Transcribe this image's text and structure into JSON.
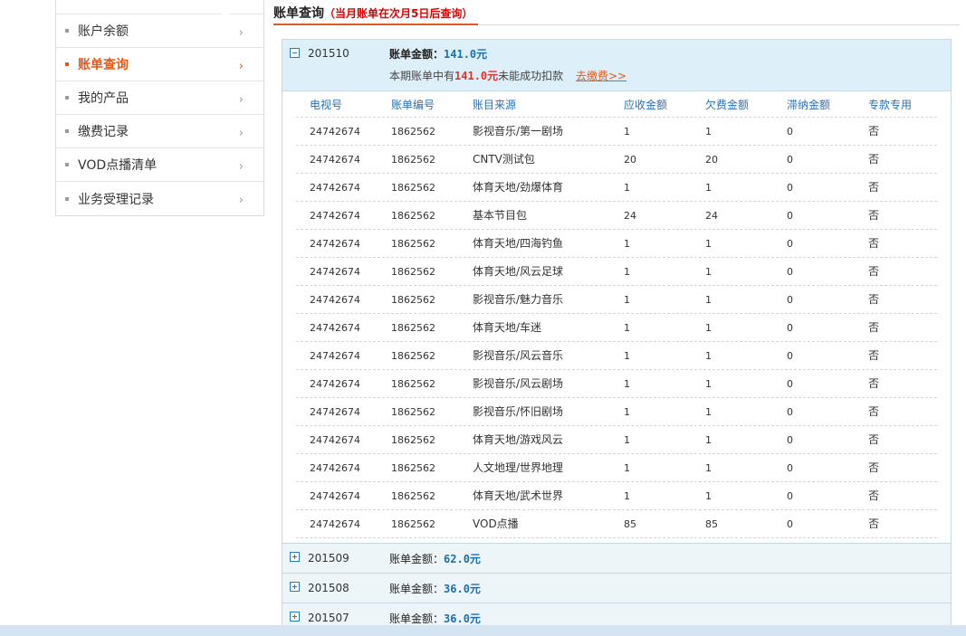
{
  "sidebar": {
    "items": [
      {
        "label": "账户余额",
        "active": false
      },
      {
        "label": "账单查询",
        "active": true
      },
      {
        "label": "我的产品",
        "active": false
      },
      {
        "label": "缴费记录",
        "active": false
      },
      {
        "label": "VOD点播清单",
        "active": false
      },
      {
        "label": "业务受理记录",
        "active": false
      }
    ],
    "chevron": "›"
  },
  "header": {
    "title": "账单查询",
    "note": "（当月账单在次月5日后查询）"
  },
  "bills": [
    {
      "period": "201510",
      "amount_label": "账单金额：",
      "amount": "141.0元",
      "expanded": true,
      "unpaid_prefix": "本期账单中有",
      "unpaid_amount": "141.0元",
      "unpaid_suffix": "未能成功扣款",
      "pay_link": "去缴费>>"
    }
  ],
  "table": {
    "columns": [
      "电视号",
      "账单编号",
      "账目来源",
      "应收金额",
      "欠费金额",
      "滞纳金额",
      "专款专用"
    ],
    "rows": [
      [
        "24742674",
        "1862562",
        "影视音乐/第一剧场",
        "1",
        "1",
        "0",
        "否"
      ],
      [
        "24742674",
        "1862562",
        "CNTV测试包",
        "20",
        "20",
        "0",
        "否"
      ],
      [
        "24742674",
        "1862562",
        "体育天地/劲爆体育",
        "1",
        "1",
        "0",
        "否"
      ],
      [
        "24742674",
        "1862562",
        "基本节目包",
        "24",
        "24",
        "0",
        "否"
      ],
      [
        "24742674",
        "1862562",
        "体育天地/四海钓鱼",
        "1",
        "1",
        "0",
        "否"
      ],
      [
        "24742674",
        "1862562",
        "体育天地/风云足球",
        "1",
        "1",
        "0",
        "否"
      ],
      [
        "24742674",
        "1862562",
        "影视音乐/魅力音乐",
        "1",
        "1",
        "0",
        "否"
      ],
      [
        "24742674",
        "1862562",
        "体育天地/车迷",
        "1",
        "1",
        "0",
        "否"
      ],
      [
        "24742674",
        "1862562",
        "影视音乐/风云音乐",
        "1",
        "1",
        "0",
        "否"
      ],
      [
        "24742674",
        "1862562",
        "影视音乐/风云剧场",
        "1",
        "1",
        "0",
        "否"
      ],
      [
        "24742674",
        "1862562",
        "影视音乐/怀旧剧场",
        "1",
        "1",
        "0",
        "否"
      ],
      [
        "24742674",
        "1862562",
        "体育天地/游戏风云",
        "1",
        "1",
        "0",
        "否"
      ],
      [
        "24742674",
        "1862562",
        "人文地理/世界地理",
        "1",
        "1",
        "0",
        "否"
      ],
      [
        "24742674",
        "1862562",
        "体育天地/武术世界",
        "1",
        "1",
        "0",
        "否"
      ],
      [
        "24742674",
        "1862562",
        "VOD点播",
        "85",
        "85",
        "0",
        "否"
      ]
    ]
  },
  "collapsed_bills": [
    {
      "period": "201509",
      "amount_label": "账单金额：",
      "amount": "62.0元"
    },
    {
      "period": "201508",
      "amount_label": "账单金额：",
      "amount": "36.0元"
    },
    {
      "period": "201507",
      "amount_label": "账单金额：",
      "amount": "36.0元"
    }
  ],
  "colors": {
    "accent": "#e05a1a",
    "link_blue": "#1a6fb0",
    "header_bg": "#ddf0fa",
    "alert_red": "#e0322a"
  },
  "icons": {
    "expanded": "minus-box-icon",
    "collapsed": "plus-box-icon"
  }
}
